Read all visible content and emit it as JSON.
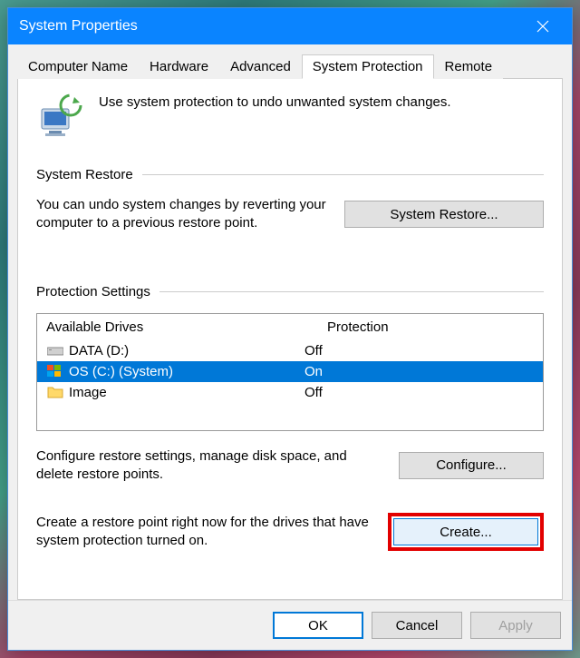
{
  "window": {
    "title": "System Properties"
  },
  "tabs": [
    {
      "label": "Computer Name"
    },
    {
      "label": "Hardware"
    },
    {
      "label": "Advanced"
    },
    {
      "label": "System Protection"
    },
    {
      "label": "Remote"
    }
  ],
  "intro": {
    "text": "Use system protection to undo unwanted system changes."
  },
  "sections": {
    "restore": {
      "title": "System Restore",
      "desc": "You can undo system changes by reverting your computer to a previous restore point.",
      "button": "System Restore..."
    },
    "protection": {
      "title": "Protection Settings",
      "headers": {
        "drive": "Available Drives",
        "prot": "Protection"
      },
      "drives": [
        {
          "icon": "hdd",
          "name": "DATA (D:)",
          "prot": "Off",
          "selected": false
        },
        {
          "icon": "sys",
          "name": "OS (C:) (System)",
          "prot": "On",
          "selected": true
        },
        {
          "icon": "folder",
          "name": "Image",
          "prot": "Off",
          "selected": false
        }
      ],
      "configure": {
        "desc": "Configure restore settings, manage disk space, and delete restore points.",
        "button": "Configure..."
      },
      "create": {
        "desc": "Create a restore point right now for the drives that have system protection turned on.",
        "button": "Create..."
      }
    }
  },
  "buttons": {
    "ok": "OK",
    "cancel": "Cancel",
    "apply": "Apply"
  }
}
